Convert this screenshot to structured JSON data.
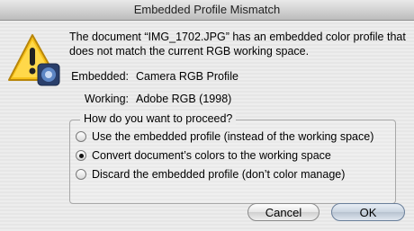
{
  "window": {
    "title": "Embedded Profile Mismatch"
  },
  "message": "The document “IMG_1702.JPG” has an embedded color profile that does not match the current RGB working space.",
  "profiles": {
    "embedded_label": "Embedded:",
    "embedded_value": "Camera RGB Profile",
    "working_label": "Working:",
    "working_value": "Adobe RGB (1998)"
  },
  "options": {
    "legend": "How do you want to proceed?",
    "items": [
      {
        "label": "Use the embedded profile (instead of the working space)",
        "selected": false
      },
      {
        "label": "Convert document’s colors to the working space",
        "selected": true
      },
      {
        "label": "Discard the embedded profile (don’t color manage)",
        "selected": false
      }
    ]
  },
  "buttons": {
    "cancel": "Cancel",
    "ok": "OK"
  },
  "icons": {
    "alert": "warning-triangle-icon",
    "app": "photoshop-app-icon"
  }
}
